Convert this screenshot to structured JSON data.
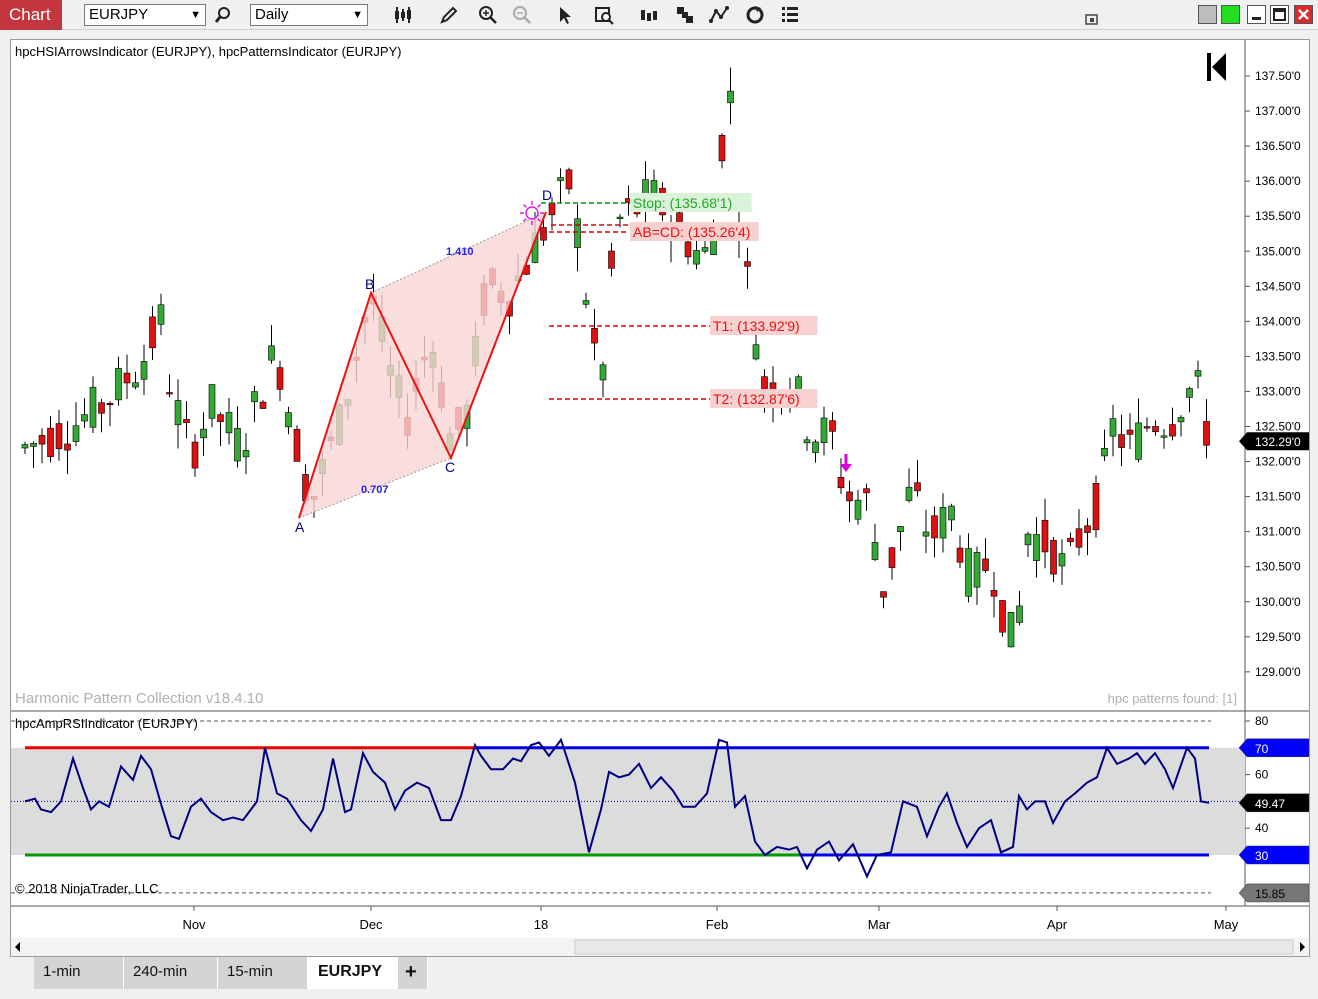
{
  "toolbar": {
    "chart_label": "Chart",
    "instrument": "EURJPY",
    "period": "Daily"
  },
  "price_panel": {
    "title": "hpcHSIArrowsIndicator (EURJPY), hpcPatternsIndicator (EURJPY)",
    "watermark": "Harmonic Pattern Collection v18.4.10",
    "patterns_found": "hpc patterns found: [1]",
    "price_ticks": [
      "137.50'0",
      "137.00'0",
      "136.50'0",
      "136.00'0",
      "135.50'0",
      "135.00'0",
      "134.50'0",
      "134.00'0",
      "133.50'0",
      "133.00'0",
      "132.50'0",
      "132.00'0",
      "131.50'0",
      "131.00'0",
      "130.50'0",
      "130.00'0",
      "129.50'0",
      "129.00'0"
    ],
    "last_price": "132.29'0",
    "pattern_points": [
      "A",
      "B",
      "C",
      "D"
    ],
    "ratio_ab_cd": "1.410",
    "ratio_bc": "0.707",
    "stop_label": "Stop: (135.68'1)",
    "abcd_label": "AB=CD: (135.26'4)",
    "t1_label": "T1: (133.92'9)",
    "t2_label": "T2: (132.87'6)"
  },
  "rsi_panel": {
    "title": "hpcAmpRSIIndicator (EURJPY)",
    "copyright": "© 2018 NinjaTrader, LLC",
    "ticks": [
      "80",
      "60",
      "40"
    ],
    "badge_70": "70",
    "badge_value": "49.47",
    "badge_30": "30",
    "badge_low": "15.85"
  },
  "time_axis": [
    "Nov",
    "Dec",
    "18",
    "Feb",
    "Mar",
    "Apr",
    "May"
  ],
  "tabs": [
    "1-min",
    "240-min",
    "15-min",
    "EURJPY"
  ],
  "add_tab": "+",
  "colors": {
    "up_candle": "#33aa33",
    "down_candle": "#dd1111",
    "pattern_line": "#ee1111",
    "rsi_line": "#000080",
    "level_70": "#0000ee",
    "level_30": "#009900",
    "badge_blue": "#0000ff",
    "toolbar_tab": "#c4373f"
  }
}
